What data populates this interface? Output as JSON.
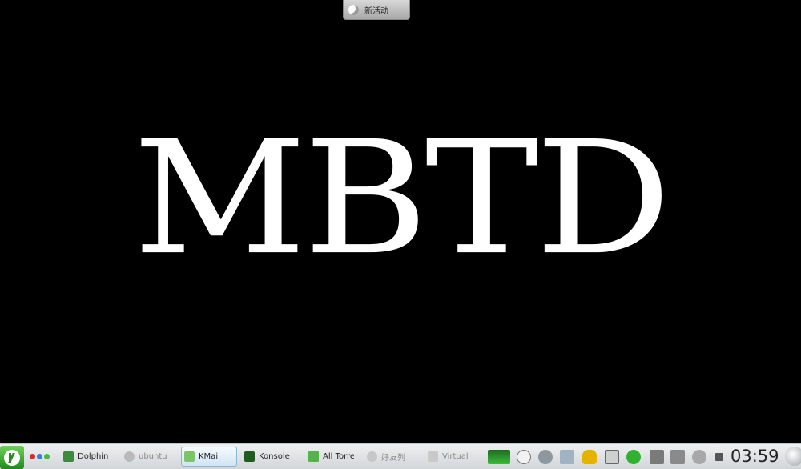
{
  "activity": {
    "label": "新活动",
    "icon": "moon-icon"
  },
  "wallpaper": {
    "text": "MBTD"
  },
  "panel": {
    "launcher_icon": "kde-logo-icon",
    "pager_colors": [
      "#d42b2b",
      "#3b7de0",
      "#3cbf3c"
    ],
    "tasks": [
      {
        "label": "Dolphin",
        "icon": "dolphin-icon"
      },
      {
        "label": "ubuntu",
        "icon": "ubuntu-icon"
      },
      {
        "label": "KMail",
        "icon": "kmail-icon",
        "active": true
      },
      {
        "label": "Konsole",
        "icon": "konsole-icon"
      },
      {
        "label": "All Torre",
        "icon": "ktorrent-icon"
      },
      {
        "label": "好友列",
        "icon": "qq-icon"
      },
      {
        "label": "Virtual",
        "icon": "virtualbox-icon"
      }
    ],
    "tray_icons": [
      "monitor-icon",
      "info-icon",
      "network-icon",
      "notes-icon",
      "penguin-icon",
      "keyboard-icon",
      "green-refresh-icon",
      "scissors-icon",
      "volume-icon",
      "wifi-icon",
      "arrow-up-icon"
    ],
    "clock": "03:59"
  }
}
